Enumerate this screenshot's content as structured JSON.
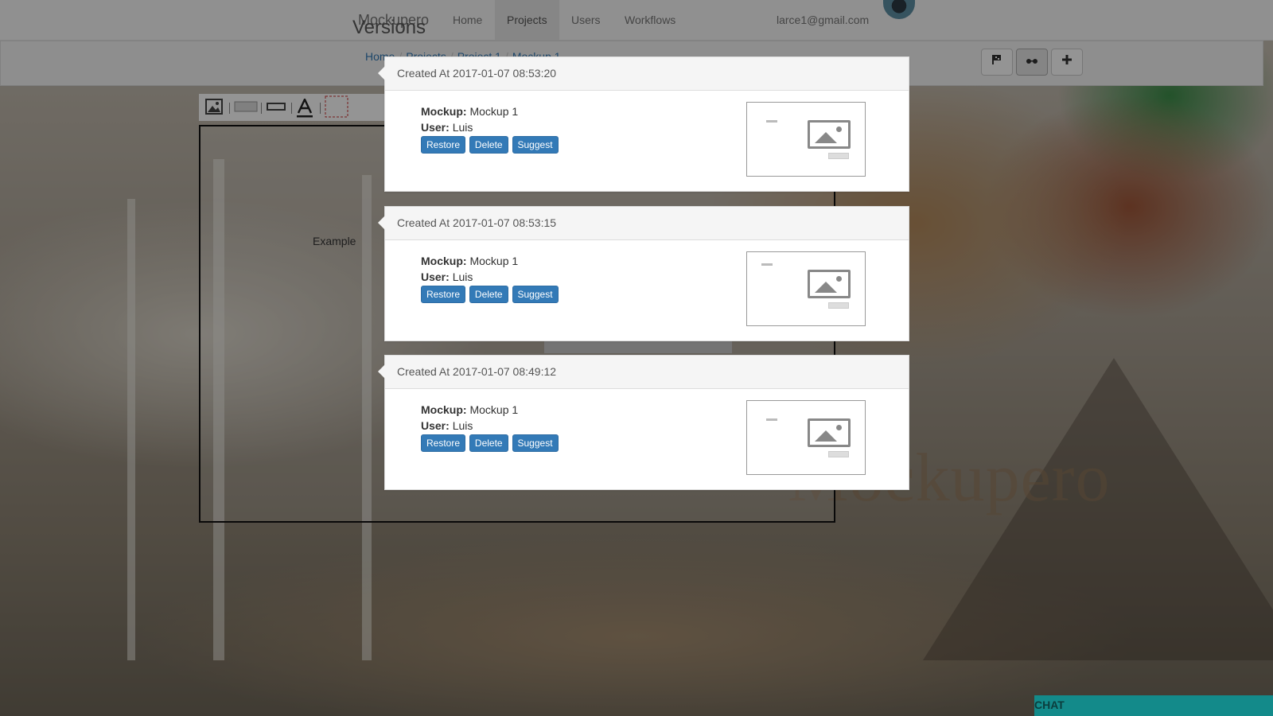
{
  "app": {
    "brand": "Mockupero",
    "watermark": "Mockupero"
  },
  "nav": {
    "items": [
      {
        "label": "Home",
        "active": false
      },
      {
        "label": "Projects",
        "active": true
      },
      {
        "label": "Users",
        "active": false
      },
      {
        "label": "Workflows",
        "active": false
      }
    ],
    "user_email": "larce1@gmail.com"
  },
  "modal": {
    "title": "Versions"
  },
  "breadcrumb": [
    "Home",
    "Projects",
    "Project 1",
    "Mockup 1"
  ],
  "toolbar": {
    "buttons": [
      {
        "icon": "flag-icon",
        "active": false
      },
      {
        "icon": "glasses-icon",
        "active": true
      },
      {
        "icon": "plus-icon",
        "active": false
      }
    ]
  },
  "editor": {
    "tools": [
      "image-icon",
      "rectangle-icon",
      "input-box-icon",
      "text-icon",
      "selection-icon"
    ],
    "canvas_label": "Example"
  },
  "labels": {
    "mockup": "Mockup:",
    "user": "User:"
  },
  "versions": [
    {
      "created": "Created At 2017-01-07 08:53:20",
      "mockup": "Mockup 1",
      "user": "Luis",
      "actions": [
        "Restore",
        "Delete",
        "Suggest"
      ]
    },
    {
      "created": "Created At 2017-01-07 08:53:15",
      "mockup": "Mockup 1",
      "user": "Luis",
      "actions": [
        "Restore",
        "Delete",
        "Suggest"
      ]
    },
    {
      "created": "Created At 2017-01-07 08:49:12",
      "mockup": "Mockup 1",
      "user": "Luis",
      "actions": [
        "Restore",
        "Delete",
        "Suggest"
      ]
    }
  ],
  "chat": {
    "label": "CHAT",
    "color": "#138a8a"
  },
  "colors": {
    "primary": "#337ab7",
    "link": "#337ab7"
  }
}
